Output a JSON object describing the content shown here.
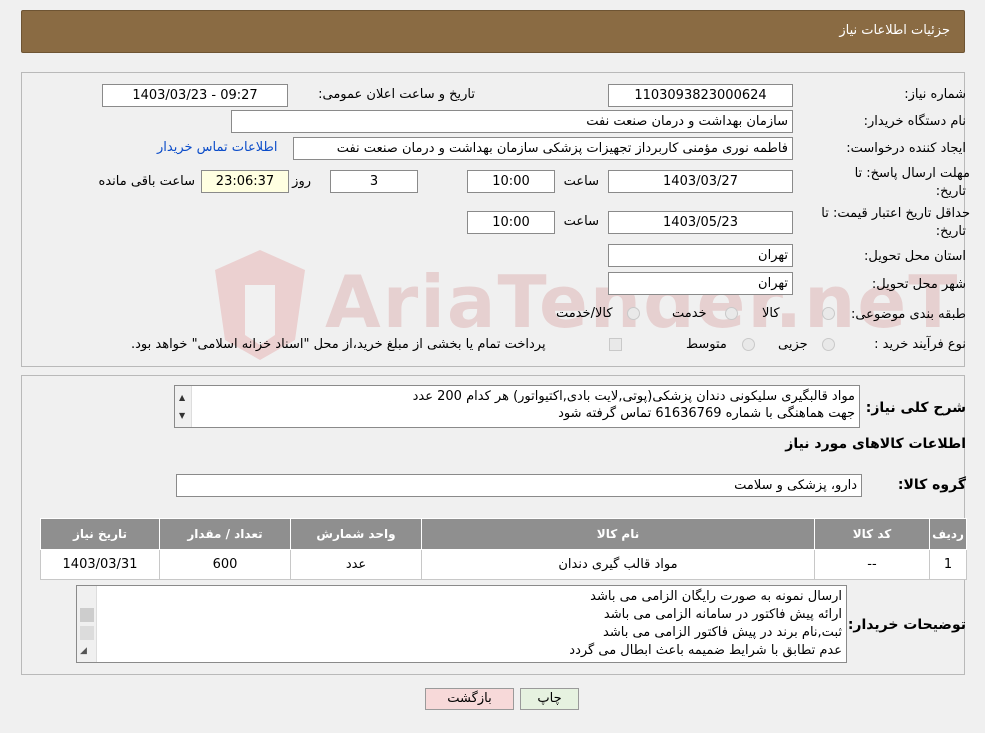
{
  "header": {
    "title": "جزئیات اطلاعات نیاز"
  },
  "form": {
    "need_number_label": "شماره نیاز:",
    "need_number": "1103093823000624",
    "announce_label": "تاریخ و ساعت اعلان عمومی:",
    "announce_value": "1403/03/23 - 09:27",
    "buyer_org_label": "نام دستگاه خریدار:",
    "buyer_org": "سازمان بهداشت و درمان صنعت نفت",
    "creator_label": "ایجاد کننده درخواست:",
    "creator": "فاطمه نوری مؤمنی کاربرداز تجهیزات پزشکی سازمان بهداشت و درمان صنعت نفت",
    "contact_link": "اطلاعات تماس خریدار",
    "deadline_label_1": "مهلت ارسال پاسخ: تا",
    "deadline_label_2": "تاریخ:",
    "deadline_date": "1403/03/27",
    "time_label": "ساعت",
    "deadline_time": "10:00",
    "days_value": "3",
    "days_label": "روز و",
    "remaining_time": "23:06:37",
    "remaining_label": "ساعت باقی مانده",
    "validity_label_1": "حداقل تاریخ اعتبار قیمت: تا",
    "validity_label_2": "تاریخ:",
    "validity_date": "1403/05/23",
    "validity_time": "10:00",
    "province_label": "استان محل تحویل:",
    "province": "تهران",
    "city_label": "شهر محل تحویل:",
    "city": "تهران",
    "category_label": "طبقه بندی موضوعی:",
    "category_options": [
      "کالا",
      "خدمت",
      "کالا/خدمت"
    ],
    "process_label": "نوع فرآیند خرید :",
    "process_options": [
      "جزیی",
      "متوسط"
    ],
    "payment_note": "پرداخت تمام یا بخشی از مبلغ خرید،از محل \"اسناد خزانه اسلامی\" خواهد بود."
  },
  "summary": {
    "label": "شرح کلی نیاز:",
    "lines": [
      "مواد قالبگیری سلیکونی دندان پزشکی(پوتی,لایت بادی,اکتیواتور) هر کدام 200 عدد",
      "جهت هماهنگی با شماره 61636769 تماس گرفته شود"
    ]
  },
  "goods": {
    "section_title": "اطلاعات کالاهای مورد نیاز",
    "group_label": "گروه کالا:",
    "group_value": "دارو، پزشکی و سلامت",
    "columns": [
      "ردیف",
      "کد کالا",
      "نام کالا",
      "واحد شمارش",
      "تعداد / مقدار",
      "تاریخ نیاز"
    ],
    "rows": [
      [
        "1",
        "--",
        "مواد قالب گیری دندان",
        "عدد",
        "600",
        "1403/03/31"
      ]
    ]
  },
  "buyer_notes": {
    "label": "توضیحات خریدار:",
    "lines": [
      "ارسال نمونه به صورت رایگان الزامی می باشد",
      "ارائه پیش فاکتور در سامانه الزامی می باشد",
      "ثبت,نام برند در پیش فاکتور الزامی می باشد",
      "عدم تطابق با شرایط ضمیمه باعث ابطال می گردد"
    ]
  },
  "buttons": {
    "print": "چاپ",
    "back": "بازگشت"
  },
  "watermark": "AriaTender.neT",
  "colors": {
    "header": "#8a6b43",
    "link": "#0b4cc9",
    "table_header": "#8f8f8f",
    "back_button": "#f7d9d9",
    "print_button": "#e6f2e0"
  }
}
